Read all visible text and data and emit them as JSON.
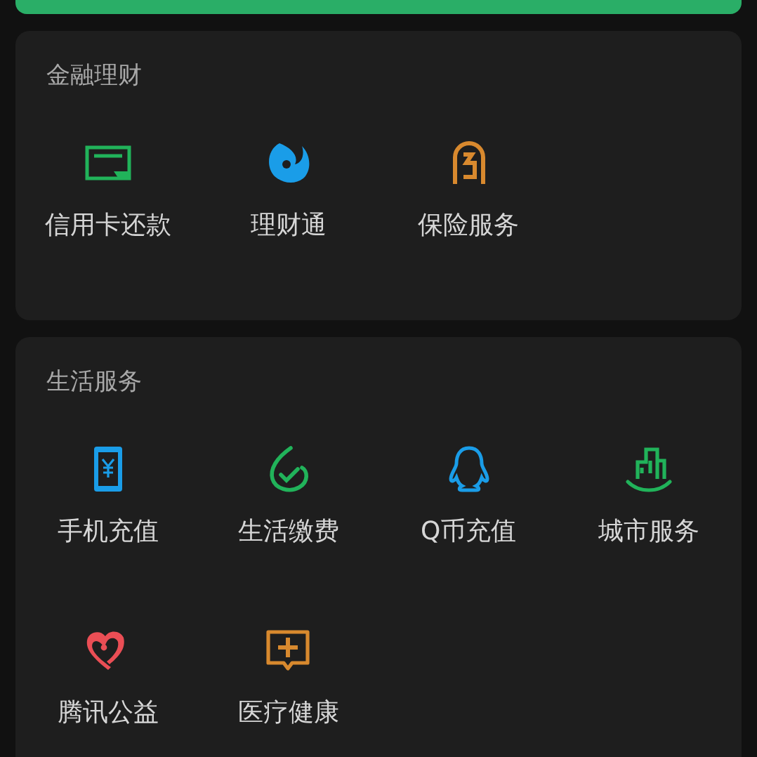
{
  "sections": [
    {
      "title": "金融理财",
      "items": [
        {
          "kind": "card",
          "label": "信用卡还款"
        },
        {
          "kind": "wealth",
          "label": "理财通"
        },
        {
          "kind": "insurance",
          "label": "保险服务"
        }
      ]
    },
    {
      "title": "生活服务",
      "items": [
        {
          "kind": "phone",
          "label": "手机充值"
        },
        {
          "kind": "utility",
          "label": "生活缴费"
        },
        {
          "kind": "penguin",
          "label": "Q币充值"
        },
        {
          "kind": "city",
          "label": "城市服务"
        },
        {
          "kind": "charity",
          "label": "腾讯公益"
        },
        {
          "kind": "medical",
          "label": "医疗健康"
        }
      ]
    }
  ]
}
